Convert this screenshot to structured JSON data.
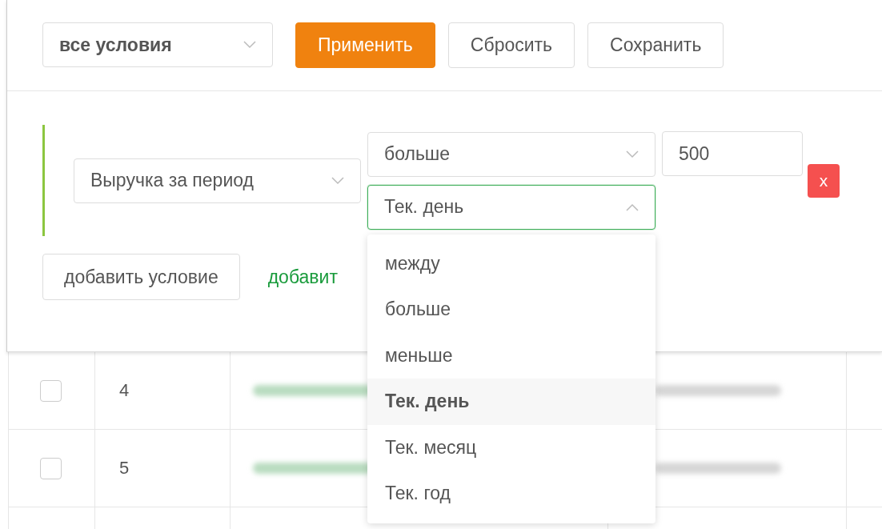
{
  "toolbar": {
    "match_select": {
      "value": "все условия"
    },
    "buttons": [
      {
        "label": "Применить",
        "kind": "primary"
      },
      {
        "label": "Сбросить",
        "kind": "default"
      },
      {
        "label": "Сохранить",
        "kind": "default"
      }
    ]
  },
  "conditions": [
    {
      "field": "Выручка за период",
      "operator": "больше",
      "value": "500",
      "remove_label": "x",
      "period": {
        "value": "Тек. день",
        "expanded": true,
        "options": [
          {
            "label": "между",
            "selected": false
          },
          {
            "label": "больше",
            "selected": false
          },
          {
            "label": "меньше",
            "selected": false
          },
          {
            "label": "Тек. день",
            "selected": true
          },
          {
            "label": "Тек. месяц",
            "selected": false
          },
          {
            "label": "Тек. год",
            "selected": false
          }
        ]
      }
    }
  ],
  "add_condition_button": "добавить условие",
  "add_group_link": "добавит",
  "table": {
    "rows": [
      {
        "checked": false,
        "number": "4"
      },
      {
        "checked": false,
        "number": "5"
      }
    ]
  }
}
